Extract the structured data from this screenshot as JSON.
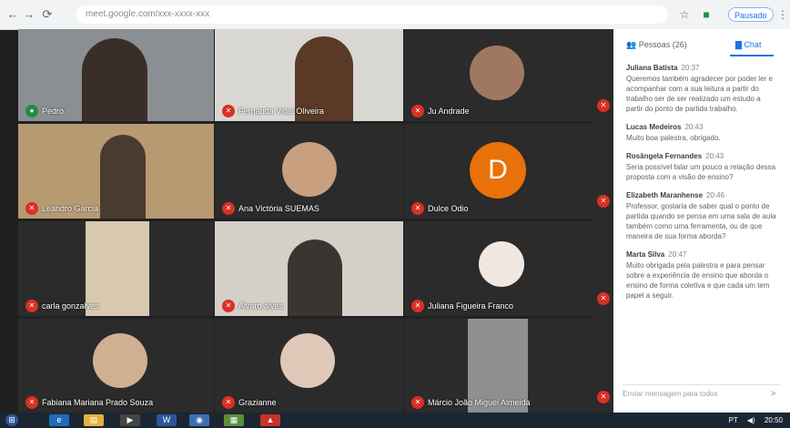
{
  "browser": {
    "url": "meet.google.com/xxx-xxxx-xxx",
    "paused_label": "Pausado",
    "back": "←",
    "forward": "→",
    "reload": "⟳",
    "star": "☆",
    "menu": "⋮"
  },
  "participants": [
    {
      "name": "Pedro",
      "mic": "on"
    },
    {
      "name": "Fernanda Vidal Oliveira",
      "mic": "off"
    },
    {
      "name": "Ju Andrade",
      "mic": "off"
    },
    {
      "name": "",
      "mic": "off"
    },
    {
      "name": "Leandro Garcia",
      "mic": "off"
    },
    {
      "name": "Ana Victória SUEMAS",
      "mic": "off"
    },
    {
      "name": "Dulce Odio",
      "mic": "off",
      "avatar_letter": "D"
    },
    {
      "name": "",
      "mic": "off"
    },
    {
      "name": "carla gonzalves",
      "mic": "off"
    },
    {
      "name": "Álvaro alves",
      "mic": "off"
    },
    {
      "name": "Juliana Figueira Franco",
      "mic": "off"
    },
    {
      "name": "",
      "mic": "off"
    },
    {
      "name": "Fabiana Mariana Prado Souza",
      "mic": "off"
    },
    {
      "name": "Grazianne",
      "mic": "off"
    },
    {
      "name": "Márcio João Miguel Almeida",
      "mic": "off"
    },
    {
      "name": "",
      "mic": "off"
    }
  ],
  "panel": {
    "tab_people": "Pessoas (26)",
    "tab_chat": "Chat",
    "messages": [
      {
        "sender": "Juliana Batista",
        "time": "20:37",
        "text": "Queremos também agradecer por poder ler e acompanhar com a sua leitura a partir do trabalho ser de ser realizado um estudo a partir do ponto de partida trabalho."
      },
      {
        "sender": "Lucas Medeiros",
        "time": "20:43",
        "text": "Muito boa palestra, obrigado."
      },
      {
        "sender": "Rosângela Fernandes",
        "time": "20:43",
        "text": "Seria possível falar um pouco a relação dessa proposta com a visão de ensino?"
      },
      {
        "sender": "Elizabeth Maranhense",
        "time": "20:46",
        "text": "Professor, gostaria de saber qual o ponto de partida quando se pensa em uma sala de aula também como uma ferramenta, ou de que maneira de sua forma aborda?"
      },
      {
        "sender": "Marta Silva",
        "time": "20:47",
        "text": "Muito obrigada pela palestra e para pensar sobre a experiência de ensino que aborda o ensino de forma coletiva e que cada um tem papel a seguir."
      }
    ],
    "compose_placeholder": "Enviar mensagem para todos",
    "send_icon": "➤"
  },
  "taskbar": {
    "clock": "20:50",
    "tray_text": "PT"
  }
}
